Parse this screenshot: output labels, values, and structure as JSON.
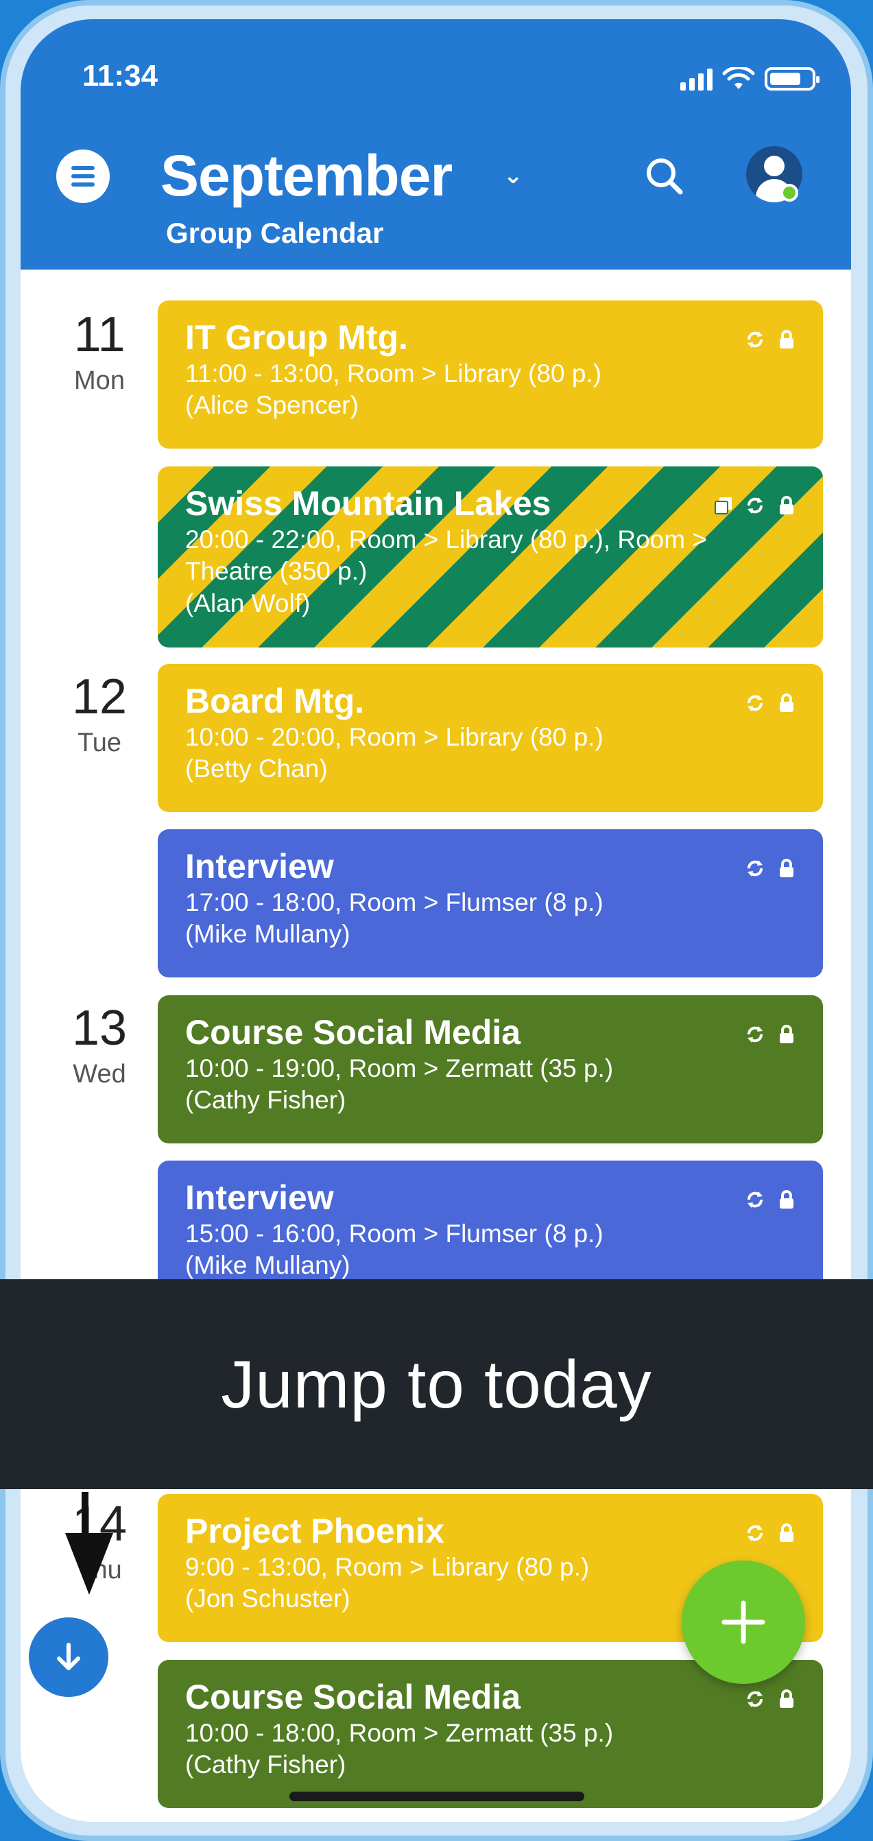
{
  "status_bar": {
    "time": "11:34"
  },
  "header": {
    "month": "September",
    "subtitle": "Group Calendar"
  },
  "days": [
    {
      "num": "11",
      "weekday": "Mon"
    },
    {
      "num": "12",
      "weekday": "Tue"
    },
    {
      "num": "13",
      "weekday": "Wed"
    },
    {
      "num": "14",
      "weekday": "Thu"
    }
  ],
  "events": [
    {
      "title": "IT Group Mtg.",
      "line1": "11:00 - 13:00, Room > Library (80 p.)",
      "line2": "(Alice Spencer)",
      "line3": "",
      "color": "yellow"
    },
    {
      "title": "Swiss Mountain Lakes",
      "line1": "20:00 - 22:00, Room > Library (80 p.), Room >",
      "line2": "Theatre (350 p.)",
      "line3": "(Alan Wolf)",
      "color": "striped"
    },
    {
      "title": "Board Mtg.",
      "line1": "10:00 - 20:00, Room > Library (80 p.)",
      "line2": "(Betty Chan)",
      "line3": "",
      "color": "yellow"
    },
    {
      "title": "Interview",
      "line1": "17:00 - 18:00, Room > Flumser (8 p.)",
      "line2": "(Mike Mullany)",
      "line3": "",
      "color": "blue"
    },
    {
      "title": "Course Social Media",
      "line1": "10:00 - 19:00, Room > Zermatt (35 p.)",
      "line2": "(Cathy Fisher)",
      "line3": "",
      "color": "green"
    },
    {
      "title": "Interview",
      "line1": "15:00 - 16:00, Room > Flumser (8 p.)",
      "line2": "(Mike Mullany)",
      "line3": "",
      "color": "blue"
    },
    {
      "title": "Project Phoenix",
      "line1": "9:00 - 13:00, Room > Library (80 p.)",
      "line2": "(Jon Schuster)",
      "line3": "",
      "color": "yellow"
    },
    {
      "title": "Course Social Media",
      "line1": "10:00 - 18:00, Room > Zermatt (35 p.)",
      "line2": "(Cathy Fisher)",
      "line3": "",
      "color": "green"
    }
  ],
  "banner": {
    "text": "Jump to today"
  },
  "icons": {
    "menu": "menu-icon",
    "search": "search-icon",
    "avatar": "user-avatar",
    "recurring": "sync-icon",
    "private": "lock-icon",
    "copy": "copy-icon",
    "today": "arrow-down-icon",
    "add": "plus-icon"
  },
  "colors": {
    "header": "#2479d3",
    "yellow": "#f0c516",
    "blue": "#4a68d8",
    "green": "#527c24",
    "stripe": "#12845a",
    "fab": "#6cc92e",
    "banner": "#20262c"
  }
}
